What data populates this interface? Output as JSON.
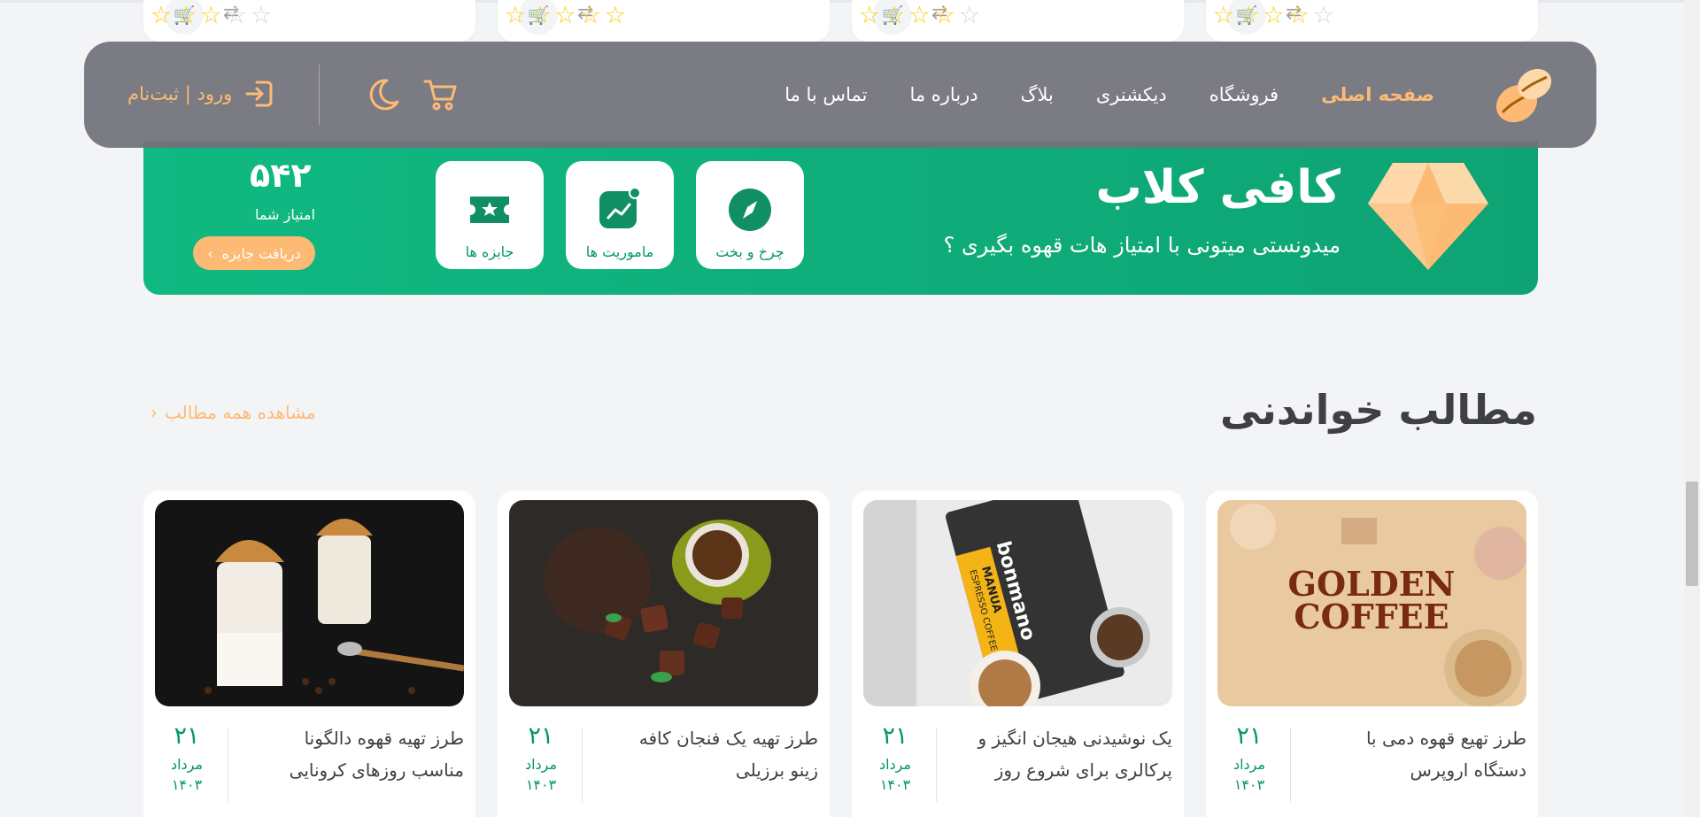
{
  "header": {
    "nav": [
      {
        "label": "صفحه اصلی",
        "active": true
      },
      {
        "label": "فروشگاه",
        "active": false
      },
      {
        "label": "دیکشنری",
        "active": false
      },
      {
        "label": "بلاگ",
        "active": false
      },
      {
        "label": "درباره ما",
        "active": false
      },
      {
        "label": "تماس با ما",
        "active": false
      }
    ],
    "login_label": "ورود | ثبت‌نام"
  },
  "top_cards": [
    {
      "rating": 4
    },
    {
      "rating": 4
    },
    {
      "rating": 5
    },
    {
      "rating": 3
    }
  ],
  "club": {
    "title": "کافی کلاب",
    "subtitle": "میدونستی میتونی با امتیاز هات قهوه بگیری ؟",
    "features": [
      {
        "label": "چرخ و بخت",
        "icon": "compass-icon"
      },
      {
        "label": "ماموریت ها",
        "icon": "chart-icon"
      },
      {
        "label": "جایزه ها",
        "icon": "ticket-icon"
      }
    ],
    "points_value": "۵۴۲",
    "points_label": "امتیاز شما",
    "reward_button": "دریافت جایزه"
  },
  "articles_section": {
    "title": "مطالب خواندنی",
    "see_all": "مشاهده همه مطالب",
    "items": [
      {
        "title": "طرز تهیع قهوه دمی با دستگاه اروپرس",
        "day": "۲۱",
        "month": "مرداد",
        "year": "۱۴۰۳",
        "image": "golden-coffee",
        "image_text": [
          "GOLDEN",
          "COFFEE"
        ]
      },
      {
        "title": "یک نوشیدنی هیجان انگیز و پرکالری برای شروع روز",
        "day": "۲۱",
        "month": "مرداد",
        "year": "۱۴۰۳",
        "image": "bonmano-espresso-bag",
        "image_text": [
          "bonmano",
          "MANUA",
          "ESPRESSO COFFEE"
        ]
      },
      {
        "title": "طرز تهیه یک فنجان کافه زینو برزیلی",
        "day": "۲۱",
        "month": "مرداد",
        "year": "۱۴۰۳",
        "image": "coffee-cup-with-chocolates"
      },
      {
        "title": "طرز تهیه قهوه دالگونا مناسب روزهای کرونایی",
        "day": "۲۱",
        "month": "مرداد",
        "year": "۱۴۰۳",
        "image": "dalgona-glasses"
      }
    ]
  },
  "colors": {
    "accent": "#fdba74",
    "green": "#10b981",
    "header_bg": "#71717a"
  }
}
